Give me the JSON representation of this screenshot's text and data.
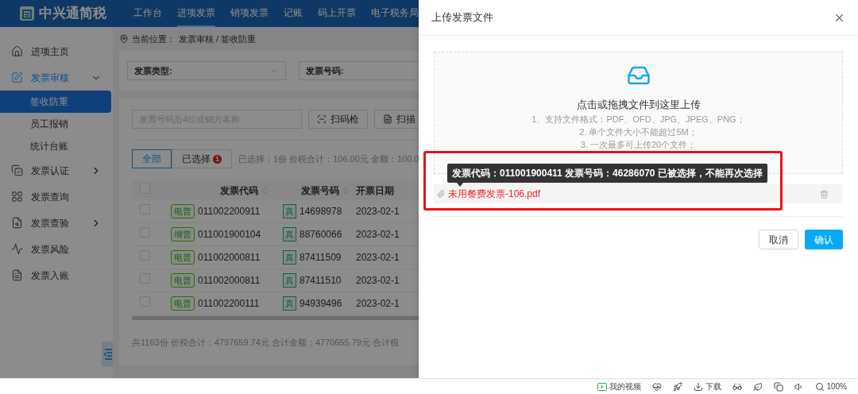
{
  "app": {
    "logo": "中兴通简税",
    "nav": [
      {
        "label": "工作台",
        "selected": false
      },
      {
        "label": "进项发票",
        "selected": true
      },
      {
        "label": "销项发票",
        "selected": false
      },
      {
        "label": "记账",
        "selected": false
      },
      {
        "label": "码上开票",
        "selected": false
      },
      {
        "label": "电子税务局",
        "selected": false
      }
    ],
    "sidebar": {
      "items": [
        {
          "label": "进项主页",
          "kind": "link",
          "selected": false
        },
        {
          "label": "发票审核",
          "kind": "group",
          "selected": true,
          "expanded": true,
          "children": [
            {
              "label": "签收防重",
              "selected": true
            },
            {
              "label": "员工报销",
              "selected": false
            },
            {
              "label": "统计台账",
              "selected": false
            }
          ]
        },
        {
          "label": "发票认证",
          "kind": "group",
          "selected": false,
          "expanded": false
        },
        {
          "label": "发票查询",
          "kind": "link",
          "selected": false
        },
        {
          "label": "发票查验",
          "kind": "group",
          "selected": false,
          "expanded": false
        },
        {
          "label": "发票风险",
          "kind": "link",
          "selected": false
        },
        {
          "label": "发票入账",
          "kind": "link",
          "selected": false
        }
      ]
    },
    "breadcrumb": {
      "label": "当前位置：",
      "path": "发票审核 / 签收防重"
    },
    "filters": [
      {
        "label": "发票类型:",
        "kind": "select"
      },
      {
        "label": "发票号码:",
        "kind": "input"
      }
    ],
    "search": {
      "placeholder": "发票号码后4位或销方名称"
    },
    "tool_buttons": [
      "扫码枪",
      "扫描"
    ],
    "tabs": [
      {
        "label": "全部",
        "selected": true
      },
      {
        "label": "已选择",
        "selected": false,
        "badge": "1"
      }
    ],
    "selection_summary": "已选择：1份 价税合计：106.00元 金额：100.0",
    "table": {
      "header_checked": false,
      "columns": [
        "发票代码",
        "发票号码",
        "开票日期"
      ],
      "rows": [
        {
          "checked": false,
          "type_tag": "电普",
          "code": "011002200911",
          "verify_tag": "真",
          "number": "14698978",
          "date": "2023-02-1"
        },
        {
          "checked": false,
          "type_tag": "增普",
          "code": "011001900104",
          "verify_tag": "真",
          "number": "88760066",
          "date": "2023-02-1"
        },
        {
          "checked": false,
          "type_tag": "电普",
          "code": "011002000811",
          "verify_tag": "真",
          "number": "87411509",
          "date": "2023-02-1"
        },
        {
          "checked": false,
          "type_tag": "电普",
          "code": "011002000811",
          "verify_tag": "真",
          "number": "87411510",
          "date": "2023-02-1"
        },
        {
          "checked": false,
          "type_tag": "电普",
          "code": "011002200111",
          "verify_tag": "真",
          "number": "94939496",
          "date": "2023-02-1"
        }
      ]
    },
    "total_summary": "共1163份 价税合计：4797659.74元 合计金额：4770655.79元 合计税"
  },
  "dialog": {
    "title": "上传发票文件",
    "upload": {
      "title": "点击或拖拽文件到这里上传",
      "hints": [
        "1、支持文件格式：PDF、OFD、JPG、JPEG、PNG；",
        "2. 单个文件大小不能超过5M；",
        "3. 一次最多可上传20个文件；"
      ]
    },
    "tooltip": "发票代码：011001900411 发票号码：46286070 已被选择，不能再次选择",
    "files": [
      {
        "name": "未用餐费发票-106.pdf",
        "error": true
      }
    ],
    "buttons": [
      {
        "label": "取消",
        "kind": "default"
      },
      {
        "label": "确认",
        "kind": "primary"
      }
    ]
  },
  "status_bar": {
    "video": "我的视频",
    "download": "下载",
    "zoom": "100%"
  }
}
